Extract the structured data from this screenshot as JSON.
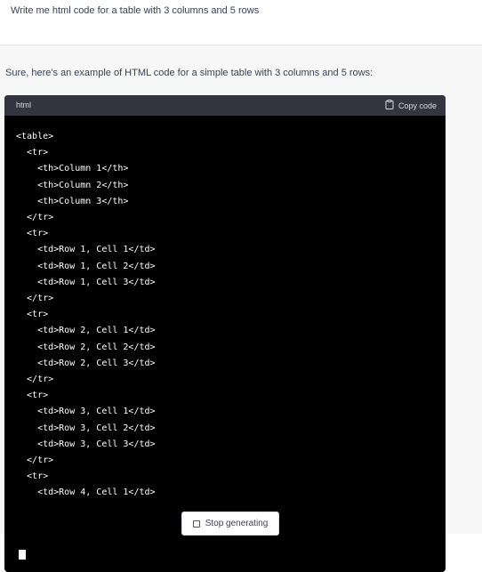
{
  "user": {
    "prompt": "Write me html code for a table with 3 columns and 5 rows"
  },
  "assistant": {
    "intro": "Sure, here's an example of HTML code for a simple table with 3 columns and 5 rows:",
    "code_block": {
      "language": "html",
      "copy_label": "Copy code",
      "copy_icon": "clipboard-icon",
      "code": "<table>\n  <tr>\n    <th>Column 1</th>\n    <th>Column 2</th>\n    <th>Column 3</th>\n  </tr>\n  <tr>\n    <td>Row 1, Cell 1</td>\n    <td>Row 1, Cell 2</td>\n    <td>Row 1, Cell 3</td>\n  </tr>\n  <tr>\n    <td>Row 2, Cell 1</td>\n    <td>Row 2, Cell 2</td>\n    <td>Row 2, Cell 3</td>\n  </tr>\n  <tr>\n    <td>Row 3, Cell 1</td>\n    <td>Row 3, Cell 2</td>\n    <td>Row 3, Cell 3</td>\n  </tr>\n  <tr>\n    <td>Row 4, Cell 1</td>"
    }
  },
  "controls": {
    "stop_label": "Stop generating",
    "stop_icon": "stop-square-icon"
  },
  "colors": {
    "code_background": "#000000",
    "code_header": "#343541",
    "assistant_background": "#f7f7f8"
  }
}
